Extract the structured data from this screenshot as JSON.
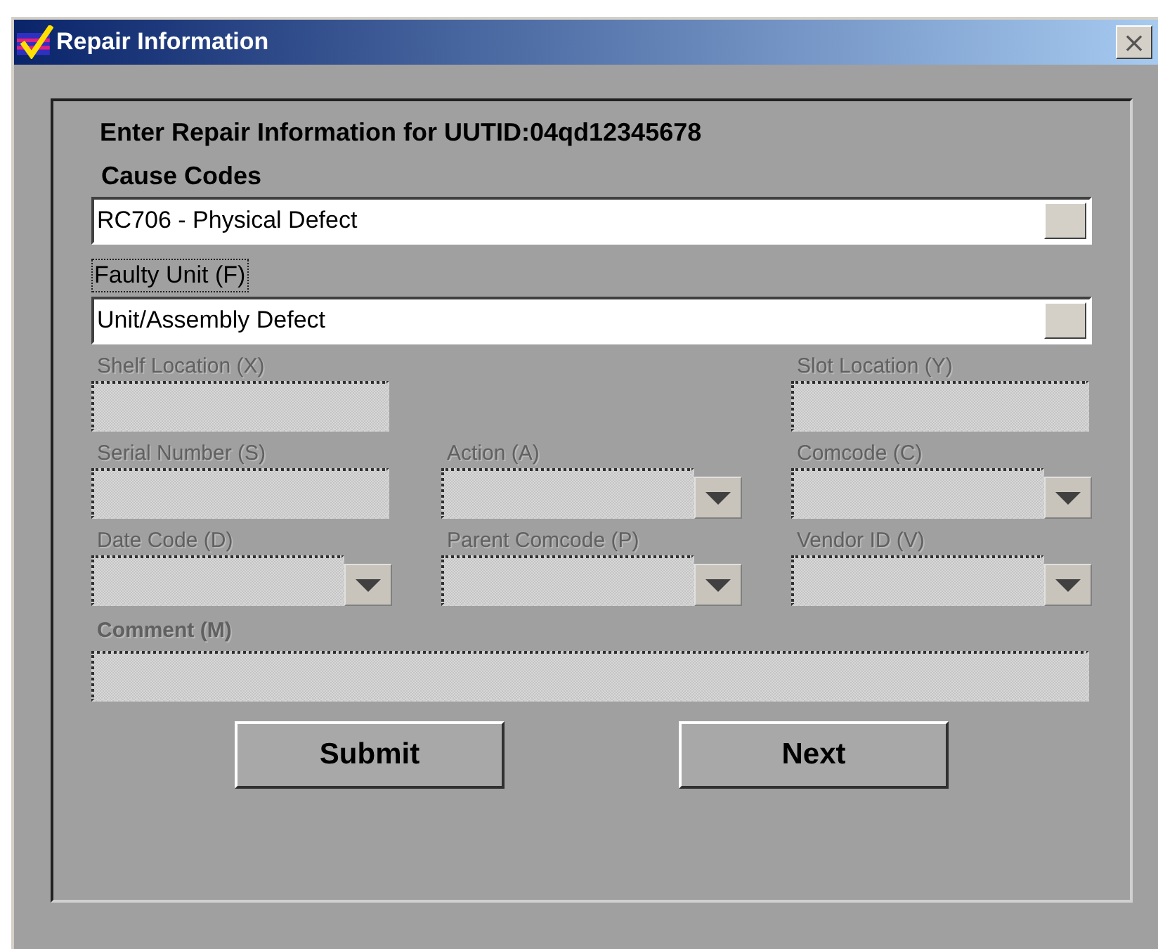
{
  "window": {
    "title": "Repair Information",
    "close": "×"
  },
  "heading": "Enter Repair Information for UUTID:04qd12345678",
  "cause_codes": {
    "label": "Cause Codes",
    "value": "RC706 - Physical Defect"
  },
  "faulty_unit": {
    "label": "Faulty Unit (F)",
    "focused": true,
    "value": "Unit/Assembly Defect"
  },
  "field_rows": [
    {
      "fields": [
        {
          "label": "Shelf Location (X)",
          "kind": "text",
          "disabled": true
        },
        {
          "label": "Slot Location (Y)",
          "kind": "text",
          "disabled": true
        }
      ]
    },
    {
      "fields": [
        {
          "label": "Serial Number (S)",
          "kind": "text",
          "disabled": true
        },
        {
          "label": "Action (A)",
          "kind": "combo",
          "disabled": true
        },
        {
          "label": "Comcode (C)",
          "kind": "combo",
          "disabled": true
        }
      ]
    },
    {
      "fields": [
        {
          "label": "Date Code (D)",
          "kind": "combo",
          "disabled": true
        },
        {
          "label": "Parent Comcode (P)",
          "kind": "combo",
          "disabled": true
        },
        {
          "label": "Vendor ID (V)",
          "kind": "combo",
          "disabled": true
        }
      ]
    }
  ],
  "comment": {
    "label": "Comment (M)",
    "disabled": true
  },
  "buttons": [
    "Submit",
    "Next"
  ]
}
